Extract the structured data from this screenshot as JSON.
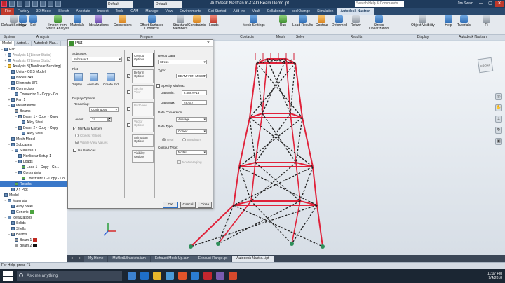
{
  "app": {
    "title": "Autodesk Nastran In-CAD Beam Demo.ipt",
    "doc_dropdown_1": "Default",
    "doc_dropdown_2": "Default",
    "search_placeholder": "Search Help & Commands...",
    "user": "Jim.Swain",
    "window_buttons": [
      "—",
      "▢",
      "✕"
    ]
  },
  "ribbon_tabs": [
    "File",
    "Factory",
    "3D Model",
    "Sketch",
    "Annotate",
    "Inspect",
    "Tools",
    "CAM",
    "Manage",
    "View",
    "Environments",
    "Get Started",
    "Add-Ins",
    "Vault",
    "Collaborate",
    "coolOrange",
    "Simulation",
    "Autodesk Nastran"
  ],
  "ribbon": {
    "buttons": [
      "Default Settings",
      "New",
      "Edit",
      "Import from Stress Analysis",
      "Materials",
      "Idealizations",
      "Connectors",
      "Offset Surfaces Contacts",
      "Structural Members",
      "Constraints",
      "Loads",
      "Mesh Settings",
      "Run",
      "Load Results",
      "Contour",
      "Deformed",
      "Return",
      "Stress Linearization",
      "Object Visibility",
      "Help",
      "Tutorials",
      "Fi"
    ],
    "panels": [
      "System",
      "Analysis",
      "Prepare",
      "Contacts",
      "Mesh",
      "Solve",
      "Results",
      "Display",
      "Autodesk Nastran"
    ]
  },
  "browser": {
    "tabs": [
      "Model",
      "Autod...",
      "Autodesk Nas..."
    ],
    "tree": [
      {
        "label": "Part",
        "indent": 0,
        "toggle": "−",
        "icon": "part"
      },
      {
        "label": "Analysis 1 [Linear Static]",
        "indent": 1,
        "toggle": "+",
        "icon": "analysis",
        "dim": true
      },
      {
        "label": "Analysis 2 [Linear Static]",
        "indent": 1,
        "toggle": "+",
        "icon": "analysis",
        "dim": true
      },
      {
        "label": "Analysis 3 [Nonlinear Buckling]",
        "indent": 1,
        "toggle": "−",
        "icon": "warn"
      },
      {
        "label": "Units - CGS Model",
        "indent": 2,
        "toggle": "",
        "icon": "units"
      },
      {
        "label": "Nodes 349",
        "indent": 2,
        "toggle": "",
        "icon": "nodes"
      },
      {
        "label": "Elements 376",
        "indent": 2,
        "toggle": "",
        "icon": "elements"
      },
      {
        "label": "Connectors",
        "indent": 2,
        "toggle": "−",
        "icon": "connectors"
      },
      {
        "label": "Connector 1 - Copy - Co...",
        "indent": 3,
        "toggle": "",
        "icon": "connector"
      },
      {
        "label": "Part 1",
        "indent": 2,
        "toggle": "+",
        "icon": "part"
      },
      {
        "label": "Idealizations",
        "indent": 2,
        "toggle": "−",
        "icon": "idealization"
      },
      {
        "label": "Beams",
        "indent": 3,
        "toggle": "−",
        "icon": "beam"
      },
      {
        "label": "Beam 1 - Copy - Copy",
        "indent": 4,
        "toggle": "−",
        "icon": "beam"
      },
      {
        "label": "Alloy Steel",
        "indent": 5,
        "toggle": "",
        "icon": "material"
      },
      {
        "label": "Beam 2 - Copy - Copy",
        "indent": 4,
        "toggle": "−",
        "icon": "beam"
      },
      {
        "label": "Alloy Steel",
        "indent": 5,
        "toggle": "",
        "icon": "material"
      },
      {
        "label": "Mesh Model",
        "indent": 2,
        "toggle": "",
        "icon": "mesh"
      },
      {
        "label": "Subcases",
        "indent": 2,
        "toggle": "−",
        "icon": "subcases"
      },
      {
        "label": "Subcase 1",
        "indent": 3,
        "toggle": "−",
        "icon": "subcase"
      },
      {
        "label": "Nonlinear Setup 1",
        "indent": 4,
        "toggle": "",
        "icon": "setup"
      },
      {
        "label": "Loads",
        "indent": 4,
        "toggle": "−",
        "icon": "loads"
      },
      {
        "label": "Load 1 - Copy - Co...",
        "indent": 5,
        "toggle": "",
        "icon": "load"
      },
      {
        "label": "Constraints",
        "indent": 4,
        "toggle": "−",
        "icon": "constraints"
      },
      {
        "label": "Constraint 1 - Copy - Co...",
        "indent": 5,
        "toggle": "",
        "icon": "constraint"
      },
      {
        "label": "Results",
        "indent": 3,
        "toggle": "",
        "icon": "results",
        "selected": true
      },
      {
        "label": "XY Plot",
        "indent": 2,
        "toggle": "",
        "icon": "xyplot"
      },
      {
        "label": "Model",
        "indent": 0,
        "toggle": "−",
        "icon": "model"
      },
      {
        "label": "Materials",
        "indent": 1,
        "toggle": "−",
        "icon": "materials"
      },
      {
        "label": "Alloy Steel",
        "indent": 2,
        "toggle": "",
        "icon": "material"
      },
      {
        "label": "Generic",
        "indent": 2,
        "toggle": "",
        "icon": "material",
        "swatch": "#4ba33f"
      },
      {
        "label": "Idealizations",
        "indent": 1,
        "toggle": "−",
        "icon": "idealization"
      },
      {
        "label": "Solids",
        "indent": 2,
        "toggle": "",
        "icon": "solid"
      },
      {
        "label": "Shells",
        "indent": 2,
        "toggle": "",
        "icon": "shell"
      },
      {
        "label": "Beams",
        "indent": 2,
        "toggle": "−",
        "icon": "beam"
      },
      {
        "label": "Beam 1",
        "indent": 3,
        "toggle": "",
        "icon": "beam",
        "swatch": "#c0281f"
      },
      {
        "label": "Beam 2",
        "indent": 3,
        "toggle": "",
        "icon": "beam",
        "swatch": "#111111"
      }
    ]
  },
  "doc_tabs": [
    "My Home",
    "Muffler&Brackets.iam",
    "Exhaust Mock-Up.iam",
    "Exhaust Flange.ipt",
    "Autodesk Nastra...ipt"
  ],
  "status": "For Help, press F1",
  "taskbar": {
    "search": "Ask me anything",
    "time": "11:07 PM",
    "date": "9/4/2018"
  },
  "viewcube_label": "FRONT",
  "plot_dialog": {
    "title": "Plot",
    "subcases_label": "Subcases:",
    "subcase_value": "Subcase 1",
    "plot_label": "Plot",
    "plot_buttons": [
      "Display",
      "Animate",
      "Create AVI"
    ],
    "display_options_label": "Display Options",
    "rendering_label": "Rendering:",
    "rendering_value": "Continuous",
    "levels_label": "Levels:",
    "levels_value": "24",
    "minmax_label": "Min/Max Markers",
    "minmax_checked": true,
    "closest_values": "Closest Values",
    "visible_view_values": "Visible View Values",
    "iso_surfaces": "Iso Surfaces",
    "side_options": [
      {
        "label": "Contour Options",
        "checked": true,
        "active": true
      },
      {
        "label": "Deform Options",
        "checked": true,
        "active": false
      },
      {
        "label": "Section View",
        "checked": false,
        "active": false
      },
      {
        "label": "Part View",
        "checked": false,
        "active": false
      },
      {
        "label": "Vector Options",
        "checked": false,
        "active": false
      },
      {
        "label": "Animation Options",
        "checked": null,
        "active": false
      },
      {
        "label": "Visibility Options",
        "checked": null,
        "active": false
      }
    ],
    "result_data_label": "Result Data:",
    "result_data_value": "Stress",
    "type_label": "Type:",
    "type_value": "BEAM VON MISES STI",
    "specify_minmax": "Specify Min/Max",
    "data_min_label": "Data Min:",
    "data_min_value": "2.5887e-16",
    "data_max_label": "Data Max:",
    "data_max_value": "7876.7",
    "data_conversion_label": "Data Conversion",
    "data_conversion_value": "Average",
    "data_type_label": "Data Type:",
    "data_type_value": "Corner",
    "real_label": "Real",
    "imaginary_label": "Imaginary",
    "contour_type_label": "Contour Type:",
    "contour_type_value": "Nodal",
    "no_averaging": "No Averaging",
    "ok": "OK",
    "cancel": "Cancel",
    "close": "Close"
  },
  "colors": {
    "accent_blue": "#3a78c9",
    "beam_red": "#e0223a",
    "title_navy": "#1f3b5c"
  }
}
